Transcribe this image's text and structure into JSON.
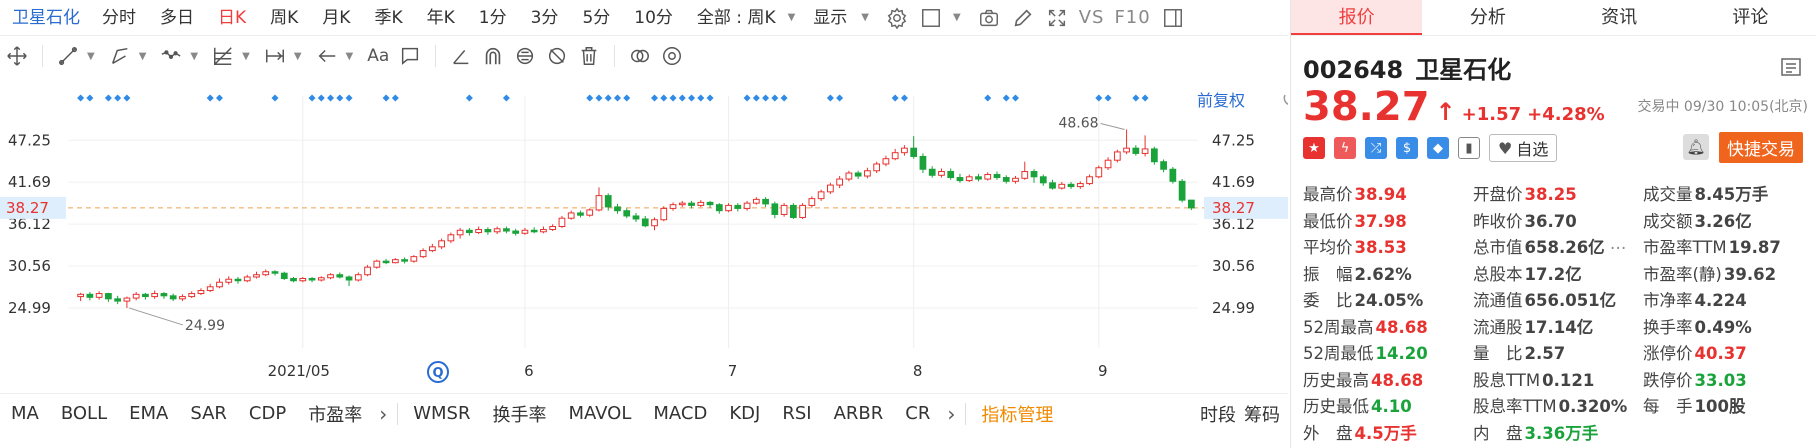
{
  "topbar": {
    "stock_name": "卫星石化",
    "periods": [
      "分时",
      "多日",
      "日K",
      "周K",
      "月K",
      "季K",
      "年K",
      "1分",
      "3分",
      "5分",
      "10分",
      "全部 : 周K"
    ],
    "active_period": "日K",
    "display_label": "显示",
    "vs_label": "VS",
    "f10_label": "F10"
  },
  "chart_header": {
    "adjust_label": "前复权"
  },
  "right_axis": {
    "current_price_tag": "38.27"
  },
  "left_axis": {
    "current_price_tag": "38.27"
  },
  "chart_data": {
    "type": "candlestick",
    "ylim": [
      21.0,
      51.0
    ],
    "y_ticks": [
      47.25,
      41.69,
      36.12,
      30.56,
      24.99
    ],
    "x_tick_labels": [
      "2021/05",
      "6",
      "7",
      "8",
      "9"
    ],
    "annotations": {
      "max_label": "48.68",
      "min_label": "24.99"
    },
    "current_price": 38.27,
    "candles": [
      [
        26.5,
        26.8,
        25.9,
        27.0
      ],
      [
        26.8,
        26.4,
        26.0,
        27.1
      ],
      [
        26.4,
        26.9,
        26.1,
        27.2
      ],
      [
        26.9,
        26.2,
        25.8,
        27.0
      ],
      [
        26.2,
        25.9,
        25.5,
        26.6
      ],
      [
        25.9,
        26.3,
        24.99,
        26.5
      ],
      [
        26.3,
        26.8,
        26.0,
        27.1
      ],
      [
        26.8,
        26.5,
        26.1,
        27.0
      ],
      [
        26.5,
        26.9,
        26.2,
        27.3
      ],
      [
        26.9,
        26.6,
        26.2,
        27.1
      ],
      [
        26.6,
        26.2,
        25.9,
        26.9
      ],
      [
        26.2,
        26.5,
        25.9,
        26.8
      ],
      [
        26.5,
        26.9,
        26.3,
        27.2
      ],
      [
        26.9,
        27.3,
        26.7,
        27.6
      ],
      [
        27.3,
        27.8,
        27.1,
        28.2
      ],
      [
        27.8,
        28.4,
        27.6,
        28.9
      ],
      [
        28.4,
        28.8,
        28.1,
        29.2
      ],
      [
        28.8,
        28.6,
        28.2,
        29.1
      ],
      [
        28.6,
        29.1,
        28.4,
        29.4
      ],
      [
        29.1,
        29.4,
        28.9,
        29.8
      ],
      [
        29.4,
        29.8,
        29.2,
        30.1
      ],
      [
        29.8,
        29.6,
        29.3,
        30.0
      ],
      [
        29.6,
        28.9,
        28.7,
        29.8
      ],
      [
        28.9,
        28.6,
        28.4,
        29.1
      ],
      [
        28.6,
        28.9,
        28.4,
        29.1
      ],
      [
        28.9,
        28.7,
        28.4,
        29.1
      ],
      [
        28.7,
        29.0,
        28.5,
        29.2
      ],
      [
        29.0,
        29.4,
        28.8,
        29.6
      ],
      [
        29.4,
        29.1,
        28.9,
        29.7
      ],
      [
        29.1,
        28.7,
        27.9,
        29.3
      ],
      [
        28.7,
        29.4,
        28.5,
        29.7
      ],
      [
        29.4,
        30.4,
        29.2,
        30.7
      ],
      [
        30.4,
        31.2,
        30.2,
        31.4
      ],
      [
        31.2,
        31.0,
        30.8,
        31.5
      ],
      [
        31.0,
        31.4,
        30.9,
        31.6
      ],
      [
        31.4,
        31.2,
        30.9,
        31.7
      ],
      [
        31.2,
        31.8,
        31.0,
        32.0
      ],
      [
        31.8,
        32.6,
        31.6,
        32.9
      ],
      [
        32.6,
        33.1,
        32.4,
        33.5
      ],
      [
        33.1,
        33.9,
        32.8,
        34.2
      ],
      [
        33.9,
        34.7,
        33.6,
        35.0
      ],
      [
        34.7,
        35.3,
        34.2,
        35.6
      ],
      [
        35.3,
        35.0,
        34.6,
        35.6
      ],
      [
        35.0,
        35.4,
        34.8,
        35.8
      ],
      [
        35.4,
        35.1,
        34.7,
        35.7
      ],
      [
        35.1,
        35.5,
        34.8,
        35.8
      ],
      [
        35.5,
        35.2,
        34.9,
        35.8
      ],
      [
        35.2,
        34.9,
        34.6,
        35.5
      ],
      [
        34.9,
        35.3,
        34.7,
        35.6
      ],
      [
        35.3,
        35.1,
        34.9,
        35.7
      ],
      [
        35.1,
        35.4,
        34.9,
        35.8
      ],
      [
        35.4,
        35.8,
        35.2,
        36.1
      ],
      [
        35.8,
        36.9,
        35.6,
        37.2
      ],
      [
        36.9,
        37.6,
        36.7,
        37.9
      ],
      [
        37.6,
        37.3,
        37.0,
        37.9
      ],
      [
        37.3,
        38.0,
        37.1,
        38.2
      ],
      [
        38.0,
        39.9,
        37.8,
        41.0
      ],
      [
        39.9,
        38.4,
        37.9,
        40.2
      ],
      [
        38.4,
        37.9,
        37.5,
        38.8
      ],
      [
        37.9,
        37.2,
        36.9,
        38.2
      ],
      [
        37.2,
        36.8,
        36.4,
        37.6
      ],
      [
        36.8,
        35.9,
        35.7,
        37.2
      ],
      [
        35.9,
        36.7,
        35.3,
        37.0
      ],
      [
        36.7,
        38.2,
        36.5,
        38.5
      ],
      [
        38.2,
        38.7,
        37.9,
        39.0
      ],
      [
        38.7,
        38.9,
        38.4,
        39.2
      ],
      [
        38.9,
        38.6,
        38.2,
        39.2
      ],
      [
        38.6,
        39.0,
        38.4,
        39.3
      ],
      [
        39.0,
        38.7,
        38.3,
        39.2
      ],
      [
        38.7,
        37.9,
        37.5,
        38.9
      ],
      [
        37.9,
        38.6,
        37.7,
        38.9
      ],
      [
        38.6,
        38.2,
        37.8,
        38.9
      ],
      [
        38.2,
        38.9,
        37.9,
        39.2
      ],
      [
        38.9,
        39.4,
        38.7,
        39.7
      ],
      [
        39.4,
        38.8,
        38.4,
        39.7
      ],
      [
        38.8,
        37.4,
        36.9,
        39.1
      ],
      [
        37.4,
        38.6,
        37.1,
        38.9
      ],
      [
        38.6,
        37.0,
        36.8,
        38.9
      ],
      [
        37.0,
        38.6,
        36.8,
        38.9
      ],
      [
        38.6,
        39.5,
        38.3,
        39.8
      ],
      [
        39.5,
        40.4,
        39.2,
        40.7
      ],
      [
        40.4,
        41.3,
        40.1,
        41.6
      ],
      [
        41.3,
        42.1,
        40.9,
        42.5
      ],
      [
        42.1,
        42.9,
        41.8,
        43.2
      ],
      [
        42.9,
        42.5,
        42.1,
        43.2
      ],
      [
        42.5,
        43.2,
        42.2,
        43.6
      ],
      [
        43.2,
        44.1,
        42.9,
        44.4
      ],
      [
        44.1,
        44.8,
        43.8,
        45.2
      ],
      [
        44.8,
        45.6,
        44.6,
        46.1
      ],
      [
        45.6,
        46.2,
        45.2,
        46.6
      ],
      [
        46.2,
        45.1,
        44.8,
        47.8
      ],
      [
        45.1,
        43.4,
        42.9,
        45.5
      ],
      [
        43.4,
        42.6,
        42.3,
        43.8
      ],
      [
        42.6,
        43.1,
        42.3,
        43.5
      ],
      [
        43.1,
        42.3,
        42.0,
        43.5
      ],
      [
        42.3,
        41.9,
        41.6,
        42.8
      ],
      [
        41.9,
        42.4,
        41.7,
        42.7
      ],
      [
        42.4,
        42.1,
        41.8,
        42.8
      ],
      [
        42.1,
        42.7,
        41.9,
        43.0
      ],
      [
        42.7,
        42.3,
        42.0,
        43.1
      ],
      [
        42.3,
        41.8,
        41.5,
        42.6
      ],
      [
        41.8,
        42.2,
        41.5,
        42.5
      ],
      [
        42.2,
        43.1,
        42.0,
        44.4
      ],
      [
        43.1,
        42.4,
        41.6,
        43.4
      ],
      [
        42.4,
        41.6,
        41.2,
        42.7
      ],
      [
        41.6,
        40.9,
        40.7,
        42.0
      ],
      [
        40.9,
        41.4,
        40.7,
        41.7
      ],
      [
        41.4,
        41.1,
        40.8,
        41.7
      ],
      [
        41.1,
        41.5,
        40.8,
        41.8
      ],
      [
        41.5,
        42.4,
        41.3,
        42.7
      ],
      [
        42.4,
        43.6,
        42.2,
        43.9
      ],
      [
        43.6,
        44.6,
        43.3,
        45.0
      ],
      [
        44.6,
        45.7,
        44.3,
        46.0
      ],
      [
        45.7,
        46.2,
        45.4,
        48.68
      ],
      [
        46.2,
        45.5,
        45.2,
        46.6
      ],
      [
        45.5,
        46.1,
        45.1,
        47.9
      ],
      [
        46.1,
        44.4,
        44.0,
        46.4
      ],
      [
        44.4,
        43.4,
        43.0,
        44.7
      ],
      [
        43.4,
        41.8,
        41.5,
        43.7
      ],
      [
        41.8,
        39.3,
        39.0,
        42.1
      ],
      [
        39.3,
        38.27,
        37.98,
        38.94
      ]
    ]
  },
  "indicators": {
    "items": [
      "MA",
      "BOLL",
      "EMA",
      "SAR",
      "CDP",
      "市盈率",
      "WMSR",
      "换手率",
      "MAVOL",
      "MACD",
      "KDJ",
      "RSI",
      "ARBR",
      "CR"
    ],
    "mgmt_label": "指标管理",
    "timeframe_label": "时段",
    "chips_label": "筹码"
  },
  "quote": {
    "tabs": [
      "报价",
      "分析",
      "资讯",
      "评论"
    ],
    "code": "002648",
    "name": "卫星石化",
    "price": "38.27",
    "change": "+1.57",
    "change_pct": "+4.28%",
    "status": "交易中 09/30 10:05(北京)",
    "watch_label": "自选",
    "trade_label": "快捷交易",
    "fields": [
      [
        [
          "最高价",
          "38.94",
          "red"
        ],
        [
          "开盘价",
          "38.25",
          "red"
        ],
        [
          "成交量",
          "8.45万手",
          ""
        ]
      ],
      [
        [
          "最低价",
          "37.98",
          "red"
        ],
        [
          "昨收价",
          "36.70",
          ""
        ],
        [
          "成交额",
          "3.26亿",
          ""
        ]
      ],
      [
        [
          "平均价",
          "38.53",
          "red"
        ],
        [
          "总市值",
          "658.26亿",
          ""
        ],
        [
          "市盈率TTM",
          "19.87",
          ""
        ]
      ],
      [
        [
          "振　幅",
          "2.62%",
          ""
        ],
        [
          "总股本",
          "17.2亿",
          ""
        ],
        [
          "市盈率(静)",
          "39.62",
          ""
        ]
      ],
      [
        [
          "委　比",
          "24.05%",
          ""
        ],
        [
          "流通值",
          "656.051亿",
          ""
        ],
        [
          "市净率",
          "4.224",
          ""
        ]
      ],
      [
        [
          "52周最高",
          "48.68",
          "red"
        ],
        [
          "流通股",
          "17.14亿",
          ""
        ],
        [
          "换手率",
          "0.49%",
          ""
        ]
      ],
      [
        [
          "52周最低",
          "14.20",
          "green"
        ],
        [
          "量　比",
          "2.57",
          ""
        ],
        [
          "涨停价",
          "40.37",
          "red"
        ]
      ],
      [
        [
          "历史最高",
          "48.68",
          "red"
        ],
        [
          "股息TTM",
          "0.121",
          ""
        ],
        [
          "跌停价",
          "33.03",
          "green"
        ]
      ],
      [
        [
          "历史最低",
          "4.10",
          "green"
        ],
        [
          "股息率TTM",
          "0.320%",
          ""
        ],
        [
          "每　手",
          "100股",
          ""
        ]
      ],
      [
        [
          "外　盘",
          "4.5万手",
          "red"
        ],
        [
          "内　盘",
          "3.36万手",
          "green"
        ],
        [
          "",
          "",
          ""
        ]
      ]
    ]
  },
  "colors": {
    "up": "#e8322f",
    "down": "#1aa33b",
    "accent": "#2a6bd1",
    "marker": "#2f8be6"
  }
}
